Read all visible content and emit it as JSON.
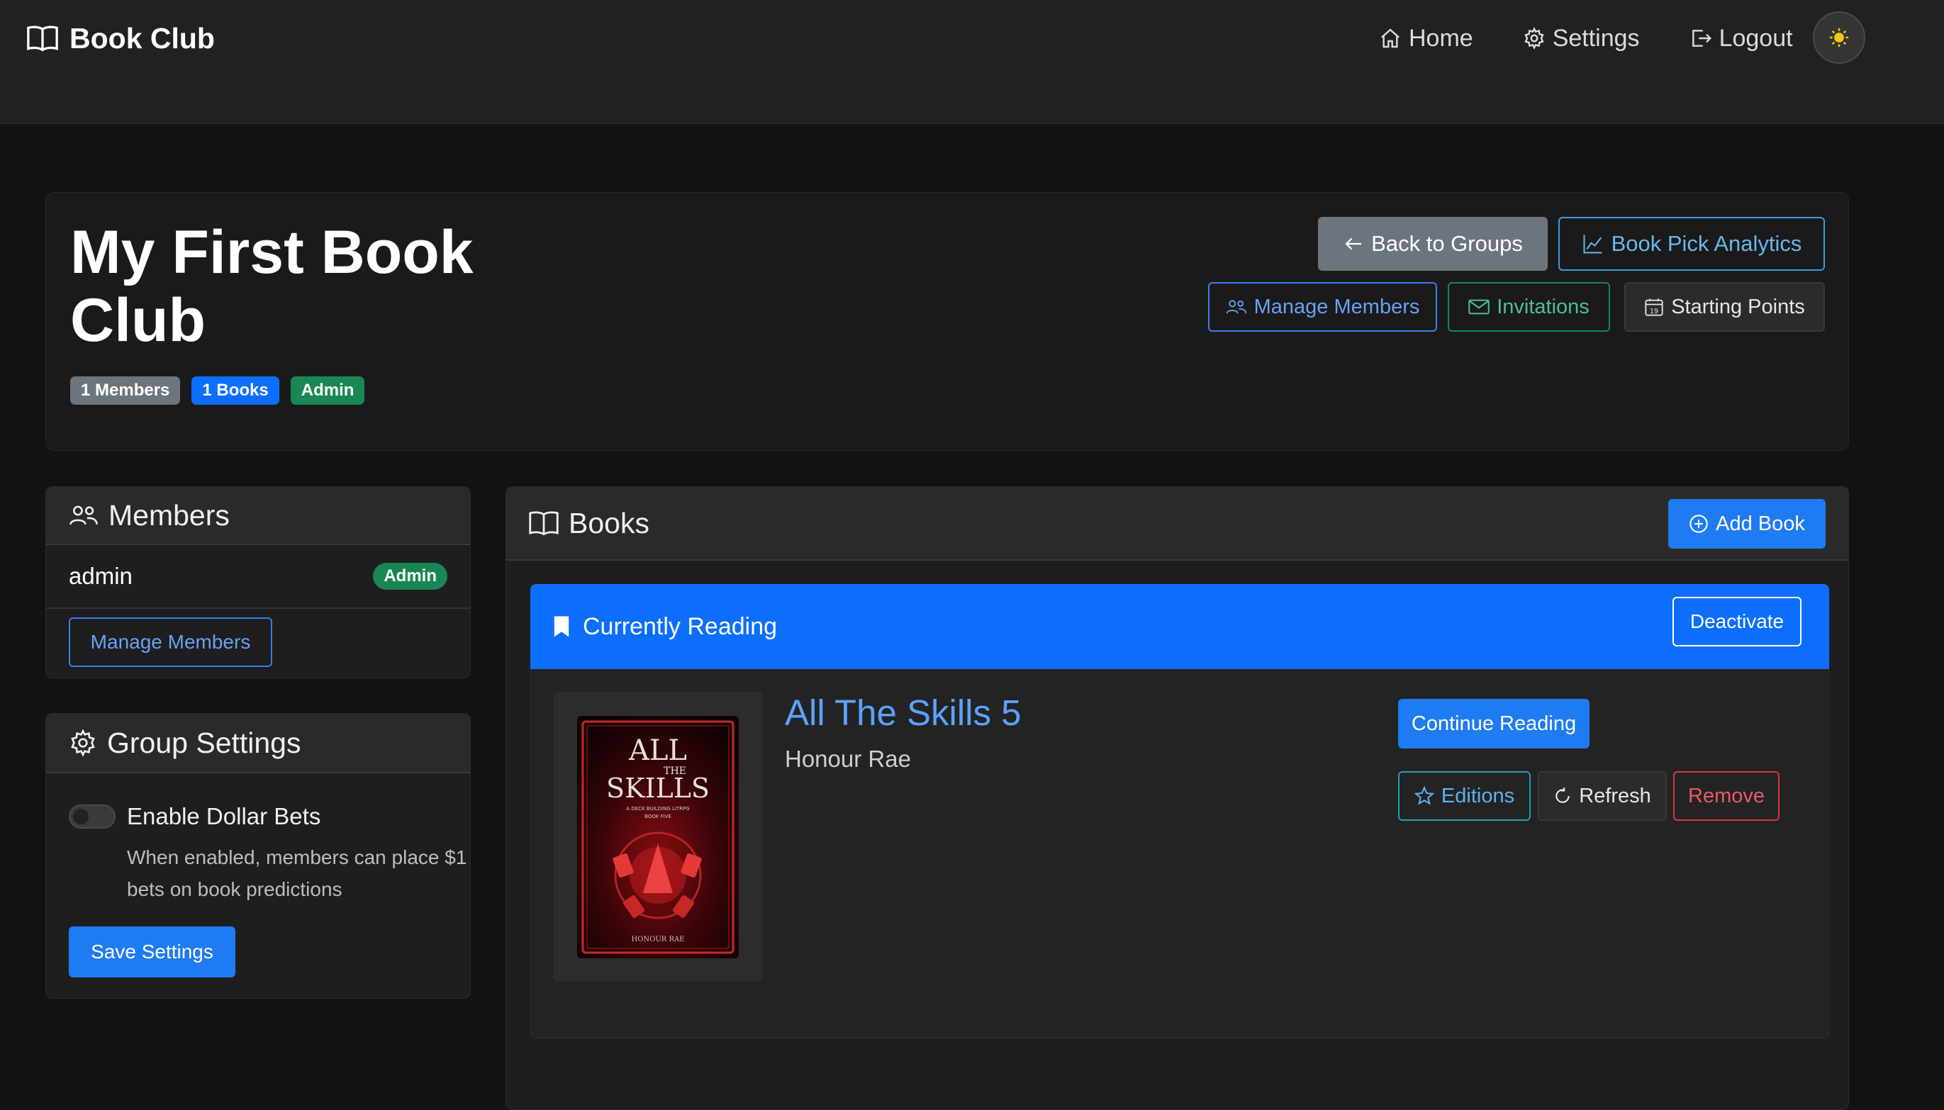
{
  "app": {
    "brand": "Book Club",
    "nav": {
      "home": "Home",
      "settings": "Settings",
      "logout": "Logout"
    },
    "theme_icon": "sun-icon"
  },
  "group": {
    "title": "My First Book Club",
    "badges": {
      "members": "1 Members",
      "books": "1 Books",
      "role": "Admin"
    },
    "actions": {
      "back": "Back to Groups",
      "analytics": "Book Pick Analytics",
      "manage_members": "Manage Members",
      "invitations": "Invitations",
      "starting_points": "Starting Points"
    }
  },
  "members_card": {
    "title": "Members",
    "members": [
      {
        "name": "admin",
        "role": "Admin"
      }
    ],
    "manage_button": "Manage Members"
  },
  "settings_card": {
    "title": "Group Settings",
    "dollar_bets": {
      "label": "Enable Dollar Bets",
      "help": "When enabled, members can place $1 bets on book predictions",
      "enabled": false
    },
    "save_button": "Save Settings"
  },
  "books_card": {
    "title": "Books",
    "add_button": "Add Book",
    "current": {
      "status": "Currently Reading",
      "deactivate": "Deactivate",
      "book": {
        "title": "All The Skills 5",
        "author": "Honour Rae",
        "cover": {
          "title_line1": "ALL",
          "title_line2": "THE",
          "title_line3": "SKILLS",
          "subtitle": "A DECK BUILDING LITRPG",
          "book_number": "BOOK FIVE",
          "author": "HONOUR RAE"
        }
      },
      "actions": {
        "continue": "Continue Reading",
        "editions": "Editions",
        "refresh": "Refresh",
        "remove": "Remove"
      }
    }
  },
  "colors": {
    "background": "#121212",
    "navbar": "#212121",
    "primary": "#0d6efd",
    "success": "#198754",
    "danger": "#dc3545",
    "link": "#5ba3ff"
  }
}
